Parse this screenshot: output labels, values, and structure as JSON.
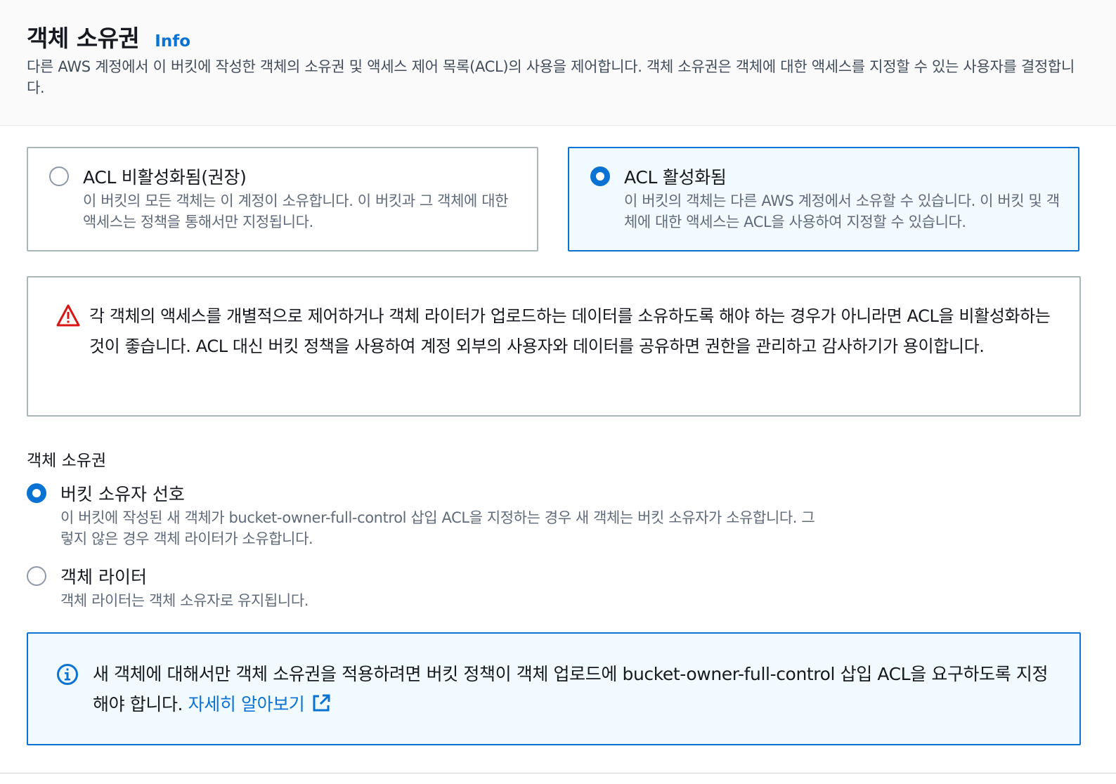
{
  "header": {
    "title": "객체 소유권",
    "info": "Info",
    "description": "다른 AWS 계정에서 이 버킷에 작성한 객체의 소유권 및 액세스 제어 목록(ACL)의 사용을 제어합니다. 객체 소유권은 객체에 대한 액세스를 지정할 수 있는 사용자를 결정합니다."
  },
  "acl_tiles": [
    {
      "title": "ACL 비활성화됨(권장)",
      "description": "이 버킷의 모든 객체는 이 계정이 소유합니다. 이 버킷과 그 객체에 대한 액세스는 정책을 통해서만 지정됩니다.",
      "selected": false
    },
    {
      "title": "ACL 활성화됨",
      "description": "이 버킷의 객체는 다른 AWS 계정에서 소유할 수 있습니다. 이 버킷 및 객체에 대한 액세스는 ACL을 사용하여 지정할 수 있습니다.",
      "selected": true
    }
  ],
  "warning": {
    "icon": "warning-icon",
    "text": "각 객체의 액세스를 개별적으로 제어하거나 객체 라이터가 업로드하는 데이터를 소유하도록 해야 하는 경우가 아니라면 ACL을 비활성화하는 것이 좋습니다. ACL 대신 버킷 정책을 사용하여 계정 외부의 사용자와 데이터를 공유하면 권한을 관리하고 감사하기가 용이합니다."
  },
  "ownership": {
    "label": "객체 소유권",
    "options": [
      {
        "title": "버킷 소유자 선호",
        "description": "이 버킷에 작성된 새 객체가 bucket-owner-full-control 삽입 ACL을 지정하는 경우 새 객체는 버킷 소유자가 소유합니다. 그렇지 않은 경우 객체 라이터가 소유합니다.",
        "selected": true
      },
      {
        "title": "객체 라이터",
        "description": "객체 라이터는 객체 소유자로 유지됩니다.",
        "selected": false
      }
    ]
  },
  "info_box": {
    "icon": "info-circle-icon",
    "text": "새 객체에 대해서만 객체 소유권을 적용하려면 버킷 정책이 객체 업로드에 bucket-owner-full-control 삽입 ACL을 요구하도록 지정해야 합니다.",
    "link": "자세히 알아보기",
    "link_icon": "external-link-icon"
  },
  "colors": {
    "accent": "#0972d3",
    "warning": "#d91515",
    "text": "#16191f",
    "muted": "#5f6b7a"
  }
}
